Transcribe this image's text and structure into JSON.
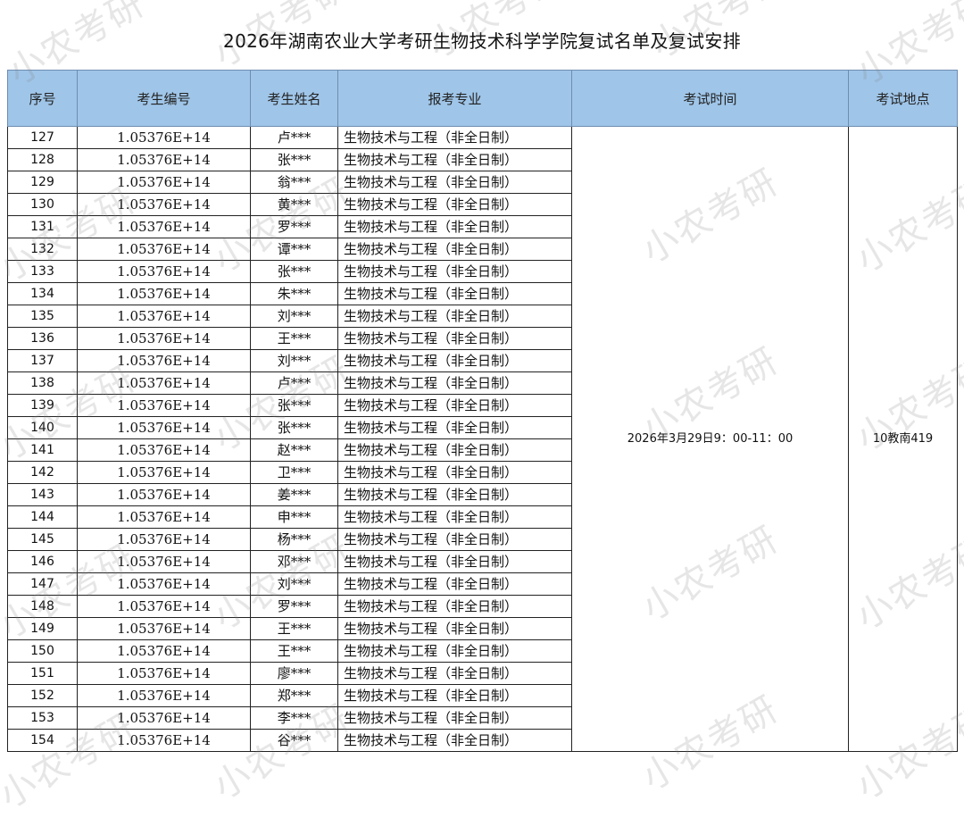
{
  "title": "2026年湖南农业大学考研生物技术科学学院复试名单及复试安排",
  "headers": {
    "no": "序号",
    "id": "考生编号",
    "name": "考生姓名",
    "major": "报考专业",
    "time": "考试时间",
    "place": "考试地点"
  },
  "exam_time": "2026年3月29日9：00-11：00",
  "exam_place": "10教南419",
  "watermark_text": "小农考研",
  "rows": [
    {
      "no": "127",
      "id": "1.05376E+14",
      "name": "卢***",
      "major": "生物技术与工程（非全日制）"
    },
    {
      "no": "128",
      "id": "1.05376E+14",
      "name": "张***",
      "major": "生物技术与工程（非全日制）"
    },
    {
      "no": "129",
      "id": "1.05376E+14",
      "name": "翁***",
      "major": "生物技术与工程（非全日制）"
    },
    {
      "no": "130",
      "id": "1.05376E+14",
      "name": "黄***",
      "major": "生物技术与工程（非全日制）"
    },
    {
      "no": "131",
      "id": "1.05376E+14",
      "name": "罗***",
      "major": "生物技术与工程（非全日制）"
    },
    {
      "no": "132",
      "id": "1.05376E+14",
      "name": "谭***",
      "major": "生物技术与工程（非全日制）"
    },
    {
      "no": "133",
      "id": "1.05376E+14",
      "name": "张***",
      "major": "生物技术与工程（非全日制）"
    },
    {
      "no": "134",
      "id": "1.05376E+14",
      "name": "朱***",
      "major": "生物技术与工程（非全日制）"
    },
    {
      "no": "135",
      "id": "1.05376E+14",
      "name": "刘***",
      "major": "生物技术与工程（非全日制）"
    },
    {
      "no": "136",
      "id": "1.05376E+14",
      "name": "王***",
      "major": "生物技术与工程（非全日制）"
    },
    {
      "no": "137",
      "id": "1.05376E+14",
      "name": "刘***",
      "major": "生物技术与工程（非全日制）"
    },
    {
      "no": "138",
      "id": "1.05376E+14",
      "name": "卢***",
      "major": "生物技术与工程（非全日制）"
    },
    {
      "no": "139",
      "id": "1.05376E+14",
      "name": "张***",
      "major": "生物技术与工程（非全日制）"
    },
    {
      "no": "140",
      "id": "1.05376E+14",
      "name": "张***",
      "major": "生物技术与工程（非全日制）"
    },
    {
      "no": "141",
      "id": "1.05376E+14",
      "name": "赵***",
      "major": "生物技术与工程（非全日制）"
    },
    {
      "no": "142",
      "id": "1.05376E+14",
      "name": "卫***",
      "major": "生物技术与工程（非全日制）"
    },
    {
      "no": "143",
      "id": "1.05376E+14",
      "name": "姜***",
      "major": "生物技术与工程（非全日制）"
    },
    {
      "no": "144",
      "id": "1.05376E+14",
      "name": "申***",
      "major": "生物技术与工程（非全日制）"
    },
    {
      "no": "145",
      "id": "1.05376E+14",
      "name": "杨***",
      "major": "生物技术与工程（非全日制）"
    },
    {
      "no": "146",
      "id": "1.05376E+14",
      "name": "邓***",
      "major": "生物技术与工程（非全日制）"
    },
    {
      "no": "147",
      "id": "1.05376E+14",
      "name": "刘***",
      "major": "生物技术与工程（非全日制）"
    },
    {
      "no": "148",
      "id": "1.05376E+14",
      "name": "罗***",
      "major": "生物技术与工程（非全日制）"
    },
    {
      "no": "149",
      "id": "1.05376E+14",
      "name": "王***",
      "major": "生物技术与工程（非全日制）"
    },
    {
      "no": "150",
      "id": "1.05376E+14",
      "name": "王***",
      "major": "生物技术与工程（非全日制）"
    },
    {
      "no": "151",
      "id": "1.05376E+14",
      "name": "廖***",
      "major": "生物技术与工程（非全日制）"
    },
    {
      "no": "152",
      "id": "1.05376E+14",
      "name": "郑***",
      "major": "生物技术与工程（非全日制）"
    },
    {
      "no": "153",
      "id": "1.05376E+14",
      "name": "李***",
      "major": "生物技术与工程（非全日制）"
    },
    {
      "no": "154",
      "id": "1.05376E+14",
      "name": "谷***",
      "major": "生物技术与工程（非全日制）"
    }
  ]
}
